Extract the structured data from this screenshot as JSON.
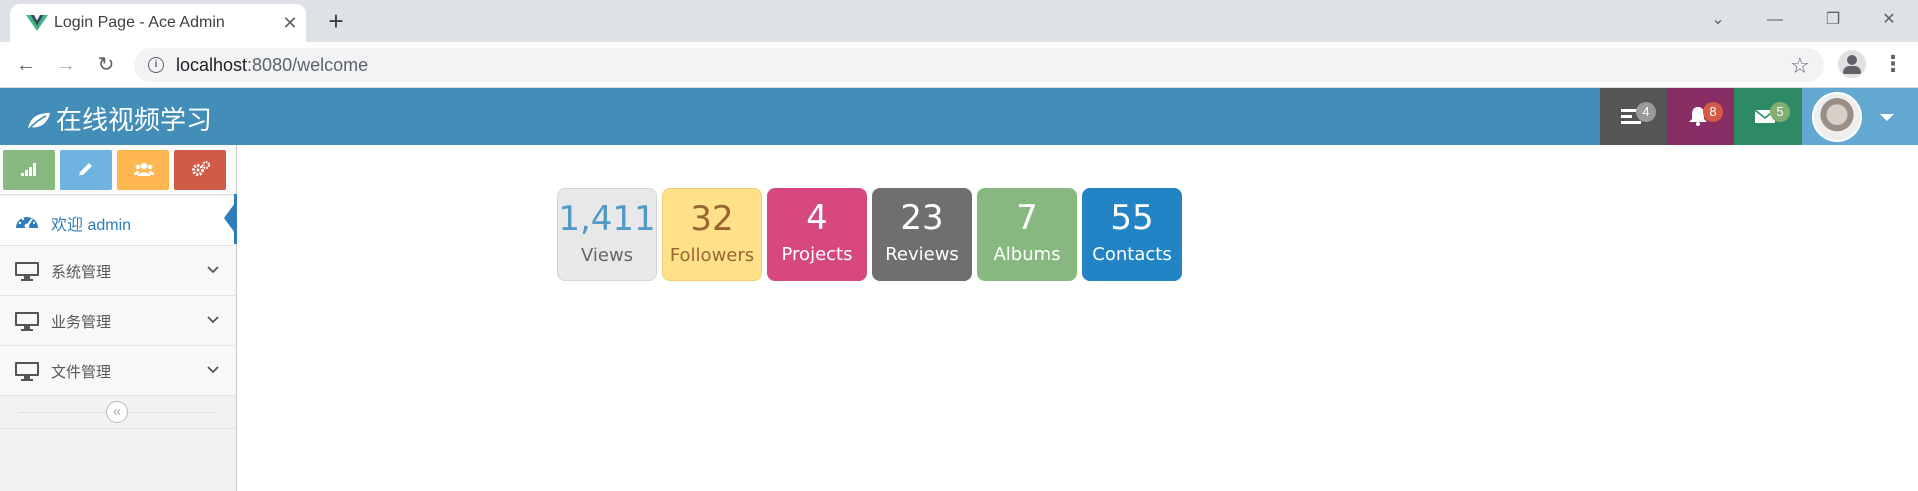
{
  "browser": {
    "tab_title": "Login Page - Ace Admin",
    "tab_close": "✕",
    "new_tab": "+",
    "url_host": "localhost",
    "url_path": ":8080/welcome",
    "back": "←",
    "forward": "→",
    "reload": "↻",
    "star": "☆",
    "menu": "⋮",
    "info": "i",
    "minimize": "—",
    "restore": "❐",
    "close": "✕",
    "tab_search": "⌄"
  },
  "navbar": {
    "brand": "在线视频学习",
    "background": "#438eb9",
    "tasks": {
      "count": "4",
      "icon": "tasks-icon",
      "bg": "#555555",
      "badge_bg": "#999999"
    },
    "notifications": {
      "count": "8",
      "icon": "bell-icon",
      "bg": "#892e65",
      "badge_bg": "#d15b47"
    },
    "messages": {
      "count": "5",
      "icon": "envelope-icon",
      "bg": "#2e8965",
      "badge_bg": "#82af6f"
    }
  },
  "sidebar": {
    "shortcuts": [
      {
        "icon": "signal-icon",
        "color": "#87b87f"
      },
      {
        "icon": "pencil-icon",
        "color": "#6fb3e0"
      },
      {
        "icon": "users-icon",
        "color": "#ffb752"
      },
      {
        "icon": "cogs-icon",
        "color": "#d15b47"
      }
    ],
    "items": [
      {
        "label": "欢迎 admin",
        "icon": "dashboard-icon",
        "active": true
      },
      {
        "label": "系统管理",
        "icon": "desktop-icon",
        "active": false
      },
      {
        "label": "业务管理",
        "icon": "desktop-icon",
        "active": false
      },
      {
        "label": "文件管理",
        "icon": "desktop-icon",
        "active": false
      }
    ],
    "collapse": "«"
  },
  "stats": [
    {
      "value": "1,411",
      "label": "Views",
      "bg": "#e8e8e8",
      "color": "#4f99c6",
      "label_color": "#666666"
    },
    {
      "value": "32",
      "label": "Followers",
      "bg": "#fee188",
      "color": "#963",
      "label_color": "#996633"
    },
    {
      "value": "4",
      "label": "Projects",
      "bg": "#d6487e",
      "color": "#ffffff",
      "label_color": "#ffffff"
    },
    {
      "value": "23",
      "label": "Reviews",
      "bg": "#6f6f6f",
      "color": "#ffffff",
      "label_color": "#ffffff"
    },
    {
      "value": "7",
      "label": "Albums",
      "bg": "#87b87f",
      "color": "#ffffff",
      "label_color": "#ffffff"
    },
    {
      "value": "55",
      "label": "Contacts",
      "bg": "#2283c5",
      "color": "#ffffff",
      "label_color": "#ffffff"
    }
  ]
}
